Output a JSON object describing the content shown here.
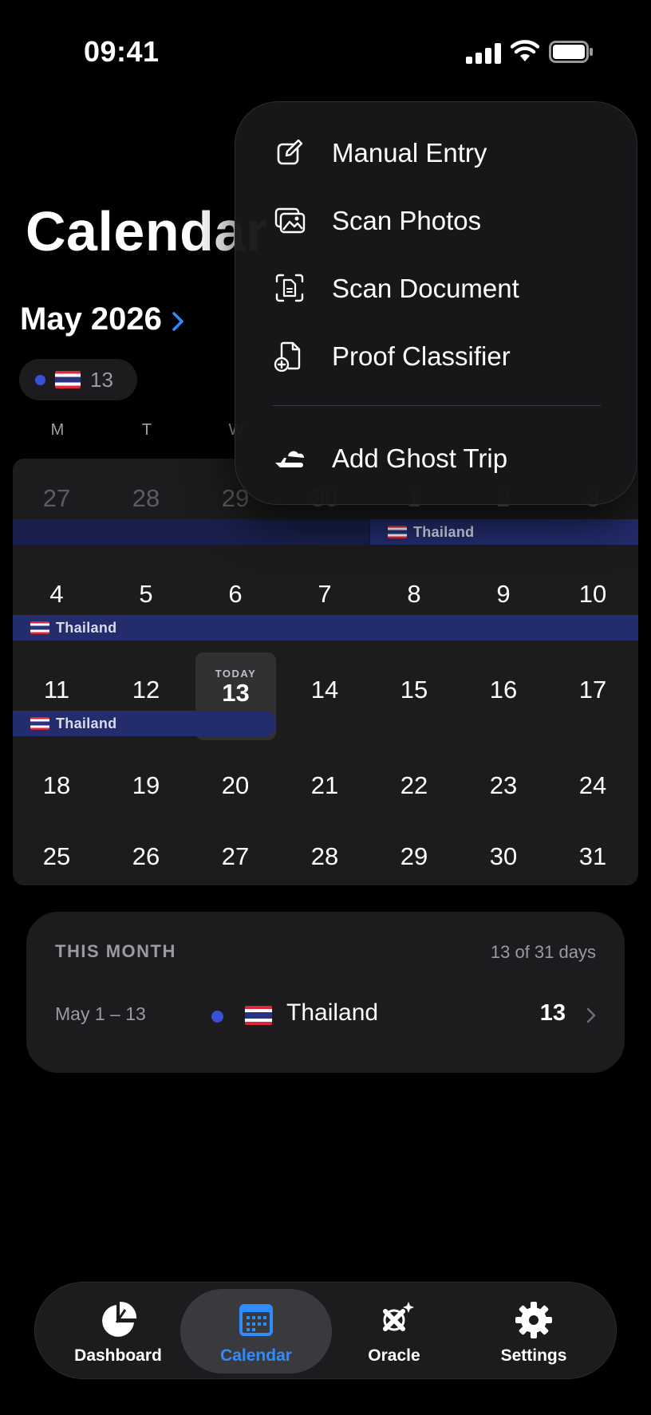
{
  "status_bar": {
    "time": "09:41"
  },
  "header": {
    "title": "Calendar",
    "month": "May 2026"
  },
  "country_chip": {
    "count": "13",
    "color": "#3a4fd8"
  },
  "weekdays": [
    "M",
    "T",
    "W"
  ],
  "calendar": {
    "row0": [
      "27",
      "28",
      "29",
      "30",
      "1",
      "2",
      "3"
    ],
    "row1": [
      "4",
      "5",
      "6",
      "7",
      "8",
      "9",
      "10"
    ],
    "row2": [
      "11",
      "12",
      "13",
      "14",
      "15",
      "16",
      "17"
    ],
    "row3": [
      "18",
      "19",
      "20",
      "21",
      "22",
      "23",
      "24"
    ],
    "row4": [
      "25",
      "26",
      "27",
      "28",
      "29",
      "30",
      "31"
    ],
    "today_label": "TODAY",
    "today_day": "13",
    "trip_label": "Thailand"
  },
  "summary": {
    "title": "THIS MONTH",
    "days": "13 of 31 days",
    "range": "May 1 – 13",
    "country": "Thailand",
    "count": "13"
  },
  "menu": {
    "items": [
      {
        "label": "Manual Entry",
        "icon": "edit-icon"
      },
      {
        "label": "Scan Photos",
        "icon": "photos-icon"
      },
      {
        "label": "Scan Document",
        "icon": "scan-document-icon"
      },
      {
        "label": "Proof Classifier",
        "icon": "document-plus-icon"
      },
      {
        "label": "Add Ghost Trip",
        "icon": "plane-cloud-icon"
      }
    ]
  },
  "tabs": [
    {
      "label": "Dashboard",
      "icon": "pie-chart-icon"
    },
    {
      "label": "Calendar",
      "icon": "calendar-icon",
      "active": true
    },
    {
      "label": "Oracle",
      "icon": "oracle-icon"
    },
    {
      "label": "Settings",
      "icon": "gear-icon"
    }
  ],
  "colors": {
    "accent": "#2f8cff",
    "trip_bar": "#232d6e",
    "dot": "#3a4fd8"
  }
}
